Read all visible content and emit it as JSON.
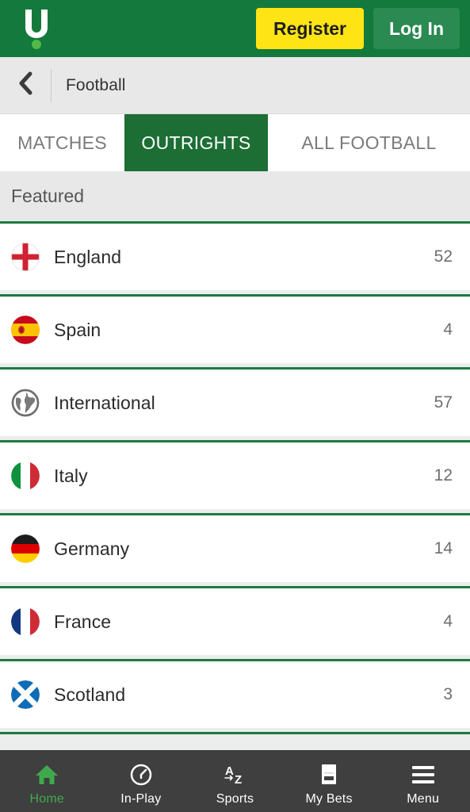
{
  "header": {
    "logo_name": "unibet-u-logo",
    "register_label": "Register",
    "login_label": "Log In",
    "bg_color": "#14793c",
    "register_color": "#ffe415",
    "login_color": "#2a8a52"
  },
  "breadcrumb": {
    "back_icon": "chevron-left-icon",
    "label": "Football"
  },
  "tabs": [
    {
      "label": "MATCHES",
      "active": false
    },
    {
      "label": "OUTRIGHTS",
      "active": true
    },
    {
      "label": "ALL FOOTBALL",
      "active": false
    }
  ],
  "section": {
    "title": "Featured",
    "accent_color": "#1d7a42"
  },
  "list": {
    "rows": [
      {
        "label": "England",
        "count": "52",
        "flag": "flag-england"
      },
      {
        "label": "Spain",
        "count": "4",
        "flag": "flag-spain"
      },
      {
        "label": "International",
        "count": "57",
        "flag": "globe-icon"
      },
      {
        "label": "Italy",
        "count": "12",
        "flag": "flag-italy"
      },
      {
        "label": "Germany",
        "count": "14",
        "flag": "flag-germany"
      },
      {
        "label": "France",
        "count": "4",
        "flag": "flag-france"
      },
      {
        "label": "Scotland",
        "count": "3",
        "flag": "flag-scotland"
      }
    ]
  },
  "bottom_nav": {
    "items": [
      {
        "label": "Home",
        "icon": "home-icon",
        "active": true
      },
      {
        "label": "In-Play",
        "icon": "clock-icon",
        "active": false
      },
      {
        "label": "Sports",
        "icon": "a-z-icon",
        "active": false
      },
      {
        "label": "My Bets",
        "icon": "betslip-icon",
        "active": false
      },
      {
        "label": "Menu",
        "icon": "hamburger-icon",
        "active": false
      }
    ],
    "bg_color": "#3f3f3f",
    "active_color": "#3faa4c"
  }
}
